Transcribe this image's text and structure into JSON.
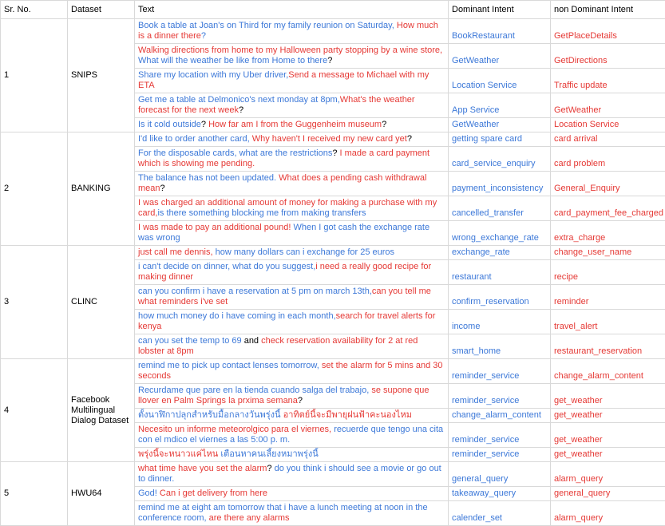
{
  "headers": {
    "sr": "Sr. No.",
    "dataset": "Dataset",
    "text": "Text",
    "dominant": "Dominant Intent",
    "nondominant": "non Dominant Intent"
  },
  "colors": {
    "blue": "#3c78d8",
    "red": "#e53935"
  },
  "groups": [
    {
      "sr": "1",
      "dataset": "SNIPS",
      "rows": [
        {
          "segments": [
            {
              "t": "Book a table at Joan's on Third for my family reunion on Saturday, ",
              "c": "blue"
            },
            {
              "t": "How much is a dinner there",
              "c": "red"
            },
            {
              "t": "?",
              "c": "blue"
            }
          ],
          "dominant": "BookRestaurant",
          "dominant_c": "blue",
          "nondominant": "GetPlaceDetails",
          "nondominant_c": "red"
        },
        {
          "segments": [
            {
              "t": "Walking directions from home to my Halloween party stopping by a wine store, ",
              "c": "red"
            },
            {
              "t": "What will the weather be like from Home to there",
              "c": "blue"
            },
            {
              "t": "?",
              "c": "black"
            }
          ],
          "dominant": "GetWeather",
          "dominant_c": "blue",
          "nondominant": "GetDirections",
          "nondominant_c": "red"
        },
        {
          "segments": [
            {
              "t": "Share my location with my Uber driver,",
              "c": "blue"
            },
            {
              "t": "Send a message to Michael with my ETA",
              "c": "red"
            }
          ],
          "dominant": "Location Service",
          "dominant_c": "blue",
          "nondominant": "Traffic update",
          "nondominant_c": "red"
        },
        {
          "segments": [
            {
              "t": "Get me a table at Delmonico's next monday at 8pm,",
              "c": "blue"
            },
            {
              "t": "What's the weather forecast for the next week",
              "c": "red"
            },
            {
              "t": "?",
              "c": "black"
            }
          ],
          "dominant": "App Service",
          "dominant_c": "blue",
          "nondominant": "GetWeather",
          "nondominant_c": "red"
        },
        {
          "segments": [
            {
              "t": "Is it cold outside",
              "c": "blue"
            },
            {
              "t": "? ",
              "c": "black"
            },
            {
              "t": "How far am I from the Guggenheim museum",
              "c": "red"
            },
            {
              "t": "?",
              "c": "black"
            }
          ],
          "dominant": "GetWeather",
          "dominant_c": "blue",
          "nondominant": "Location Service",
          "nondominant_c": "red"
        }
      ]
    },
    {
      "sr": "2",
      "dataset": "BANKING",
      "rows": [
        {
          "segments": [
            {
              "t": "I'd like to order another card, ",
              "c": "blue"
            },
            {
              "t": "Why haven't I received my new card yet",
              "c": "red"
            },
            {
              "t": "?",
              "c": "black"
            }
          ],
          "dominant": "getting spare card",
          "dominant_c": "blue",
          "nondominant": "card arrival",
          "nondominant_c": "red"
        },
        {
          "segments": [
            {
              "t": "For the disposable cards, what are the restrictions",
              "c": "blue"
            },
            {
              "t": "? ",
              "c": "black"
            },
            {
              "t": "I made a card payment which is showing me pending.",
              "c": "red"
            }
          ],
          "dominant": "card_service_enquiry",
          "dominant_c": "blue",
          "nondominant": "card problem",
          "nondominant_c": "red"
        },
        {
          "segments": [
            {
              "t": "The balance has not been updated. ",
              "c": "blue"
            },
            {
              "t": "What does a pending cash withdrawal mean",
              "c": "red"
            },
            {
              "t": "?",
              "c": "black"
            }
          ],
          "dominant": "payment_inconsistency",
          "dominant_c": "blue",
          "nondominant": "General_Enquiry",
          "nondominant_c": "red"
        },
        {
          "segments": [
            {
              "t": "I was charged an additional amount of money for making a purchase with my card,",
              "c": "red"
            },
            {
              "t": "is there something blocking me from making transfers",
              "c": "blue"
            }
          ],
          "dominant": "cancelled_transfer",
          "dominant_c": "blue",
          "nondominant": "card_payment_fee_charged",
          "nondominant_c": "red"
        },
        {
          "segments": [
            {
              "t": "I was made to pay an additional pound! ",
              "c": "red"
            },
            {
              "t": "When I got cash the exchange rate was wrong",
              "c": "blue"
            }
          ],
          "dominant": "wrong_exchange_rate",
          "dominant_c": "blue",
          "nondominant": "extra_charge",
          "nondominant_c": "red"
        }
      ]
    },
    {
      "sr": "3",
      "dataset": "CLINC",
      "rows": [
        {
          "segments": [
            {
              "t": "just call me dennis, ",
              "c": "red"
            },
            {
              "t": "how many dollars can i exchange for 25 euros",
              "c": "blue"
            }
          ],
          "dominant": "exchange_rate",
          "dominant_c": "blue",
          "nondominant": "change_user_name",
          "nondominant_c": "red"
        },
        {
          "segments": [
            {
              "t": "i can't decide on dinner, what do you suggest,",
              "c": "blue"
            },
            {
              "t": "i need a really good recipe for making dinner",
              "c": "red"
            }
          ],
          "dominant": "restaurant",
          "dominant_c": "blue",
          "nondominant": "recipe",
          "nondominant_c": "red"
        },
        {
          "segments": [
            {
              "t": "can you confirm i have a reservation at 5 pm on march 13th,",
              "c": "blue"
            },
            {
              "t": "can you tell me what reminders i've set",
              "c": "red"
            }
          ],
          "dominant": "confirm_reservation",
          "dominant_c": "blue",
          "nondominant": "reminder",
          "nondominant_c": "red"
        },
        {
          "segments": [
            {
              "t": "how much money do i have coming in each month,",
              "c": "blue"
            },
            {
              "t": "search for travel alerts for kenya",
              "c": "red"
            }
          ],
          "dominant": "income",
          "dominant_c": "blue",
          "nondominant": "travel_alert",
          "nondominant_c": "red"
        },
        {
          "segments": [
            {
              "t": "can you set the temp to 69",
              "c": "blue"
            },
            {
              "t": " and ",
              "c": "black"
            },
            {
              "t": "check reservation availability for 2 at red lobster at 8pm",
              "c": "red"
            }
          ],
          "dominant": "smart_home",
          "dominant_c": "blue",
          "nondominant": "restaurant_reservation",
          "nondominant_c": "red"
        }
      ]
    },
    {
      "sr": "4",
      "dataset": "Facebook Multilingual Dialog Dataset",
      "rows": [
        {
          "segments": [
            {
              "t": "remind me to pick up contact lenses tomorrow, ",
              "c": "blue"
            },
            {
              "t": "set the alarm for 5 mins and 30 seconds",
              "c": "red"
            }
          ],
          "dominant": "reminder_service",
          "dominant_c": "blue",
          "nondominant": "change_alarm_content",
          "nondominant_c": "red"
        },
        {
          "segments": [
            {
              "t": "Recurdame que pare en la tienda cuando salga del trabajo, ",
              "c": "blue"
            },
            {
              "t": "se supone que llover en Palm Springs la prxima semana",
              "c": "red"
            },
            {
              "t": "?",
              "c": "black"
            }
          ],
          "dominant": "reminder_service",
          "dominant_c": "blue",
          "nondominant": "get_weather",
          "nondominant_c": "red"
        },
        {
          "segments": [
            {
              "t": "ตั้งนาฬิกาปลุกสำหรับมื้อกลางวันพรุ่งนี้  ",
              "c": "blue"
            },
            {
              "t": "อาทิตย์นี้จะมีพายุฝนฟ้าคะนองไหม",
              "c": "red"
            }
          ],
          "dominant": "change_alarm_content",
          "dominant_c": "blue",
          "nondominant": "get_weather",
          "nondominant_c": "red"
        },
        {
          "segments": [
            {
              "t": "Necesito un informe meteorolgico para el viernes, ",
              "c": "red"
            },
            {
              "t": "recuerde que tengo una cita con el mdico el viernes a las 5:00 p. m.",
              "c": "blue"
            }
          ],
          "dominant": "reminder_service",
          "dominant_c": "blue",
          "nondominant": "get_weather",
          "nondominant_c": "red"
        },
        {
          "segments": [
            {
              "t": "พรุ่งนี้จะหนาวแค่ไหน  ",
              "c": "red"
            },
            {
              "t": "เตือนหาคนเลี้ยงหมาพรุ่งนี้",
              "c": "blue"
            }
          ],
          "dominant": "reminder_service",
          "dominant_c": "blue",
          "nondominant": "get_weather",
          "nondominant_c": "red"
        }
      ]
    },
    {
      "sr": "5",
      "dataset": "HWU64",
      "rows": [
        {
          "segments": [
            {
              "t": "what time have you set the alarm",
              "c": "red"
            },
            {
              "t": "? ",
              "c": "black"
            },
            {
              "t": "do you think i should see a movie or go out to dinner.",
              "c": "blue"
            }
          ],
          "dominant": "general_query",
          "dominant_c": "blue",
          "nondominant": "alarm_query",
          "nondominant_c": "red"
        },
        {
          "segments": [
            {
              "t": "God! ",
              "c": "blue"
            },
            {
              "t": "Can i get delivery from here",
              "c": "red"
            }
          ],
          "dominant": "takeaway_query",
          "dominant_c": "blue",
          "nondominant": "general_query",
          "nondominant_c": "red"
        },
        {
          "segments": [
            {
              "t": "remind me at eight am tomorrow that i have a lunch meeting at noon in the conference room, ",
              "c": "blue"
            },
            {
              "t": "are there any alarms",
              "c": "red"
            }
          ],
          "dominant": "calender_set",
          "dominant_c": "blue",
          "nondominant": "alarm_query",
          "nondominant_c": "red"
        }
      ]
    }
  ]
}
